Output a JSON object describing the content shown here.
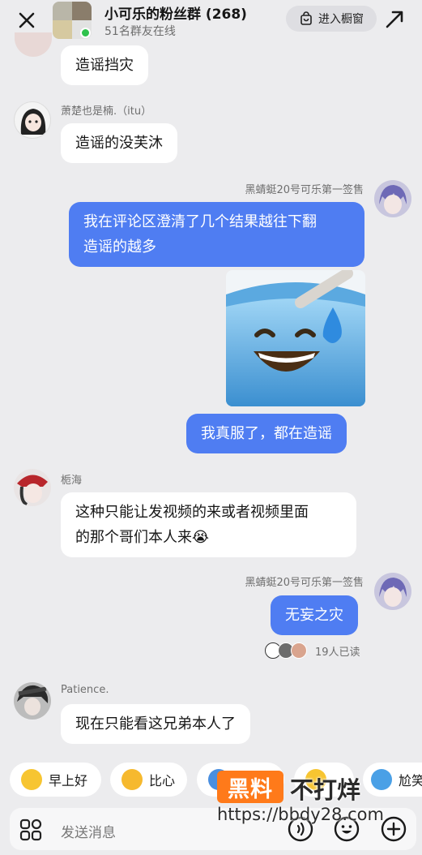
{
  "header": {
    "title": "小可乐的粉丝群 (268)",
    "subtitle": "51名群友在线",
    "enter_label": "进入橱窗",
    "close_icon": "close-icon",
    "expand_icon": "expand-icon",
    "bag_icon": "shopping-bag-icon"
  },
  "messages": [
    {
      "direction": "in",
      "text": "造谣挡灾"
    },
    {
      "direction": "in",
      "sender": "萧楚也是楠.（itu）",
      "text": "造谣的没芙沐"
    },
    {
      "direction": "out",
      "sender": "黑蜻蜓20号可乐第一签售",
      "text_lines": [
        "我在评论区澄清了几个结果越往下翻",
        "造谣的越多"
      ]
    },
    {
      "direction": "out",
      "sticker": "sweating-smile-emoji-sticker"
    },
    {
      "direction": "out",
      "text": "我真服了，都在造谣"
    },
    {
      "direction": "in",
      "sender": "栀海",
      "text_lines": [
        "这种只能让发视频的来或者视频里面",
        "的那个哥们本人来😭"
      ]
    },
    {
      "direction": "out",
      "sender": "黑蜻蜓20号可乐第一签售",
      "text": "无妄之灾",
      "read_status": "19人已读"
    },
    {
      "direction": "in",
      "sender": "Patience.",
      "text": "现在只能看这兄弟本人了"
    }
  ],
  "quick_replies": [
    "早上好",
    "比心",
    "",
    "",
    "尬笑"
  ],
  "input": {
    "placeholder": "发送消息"
  },
  "watermark": {
    "logo": "黑料",
    "text": "不打烊",
    "url": "https://bbdy28.com"
  },
  "colors": {
    "outgoing_bubble": "#4f7df2",
    "incoming_bubble": "#ffffff",
    "background": "#ececee",
    "online": "#2fc24d",
    "watermark": "#ff7a1a"
  }
}
